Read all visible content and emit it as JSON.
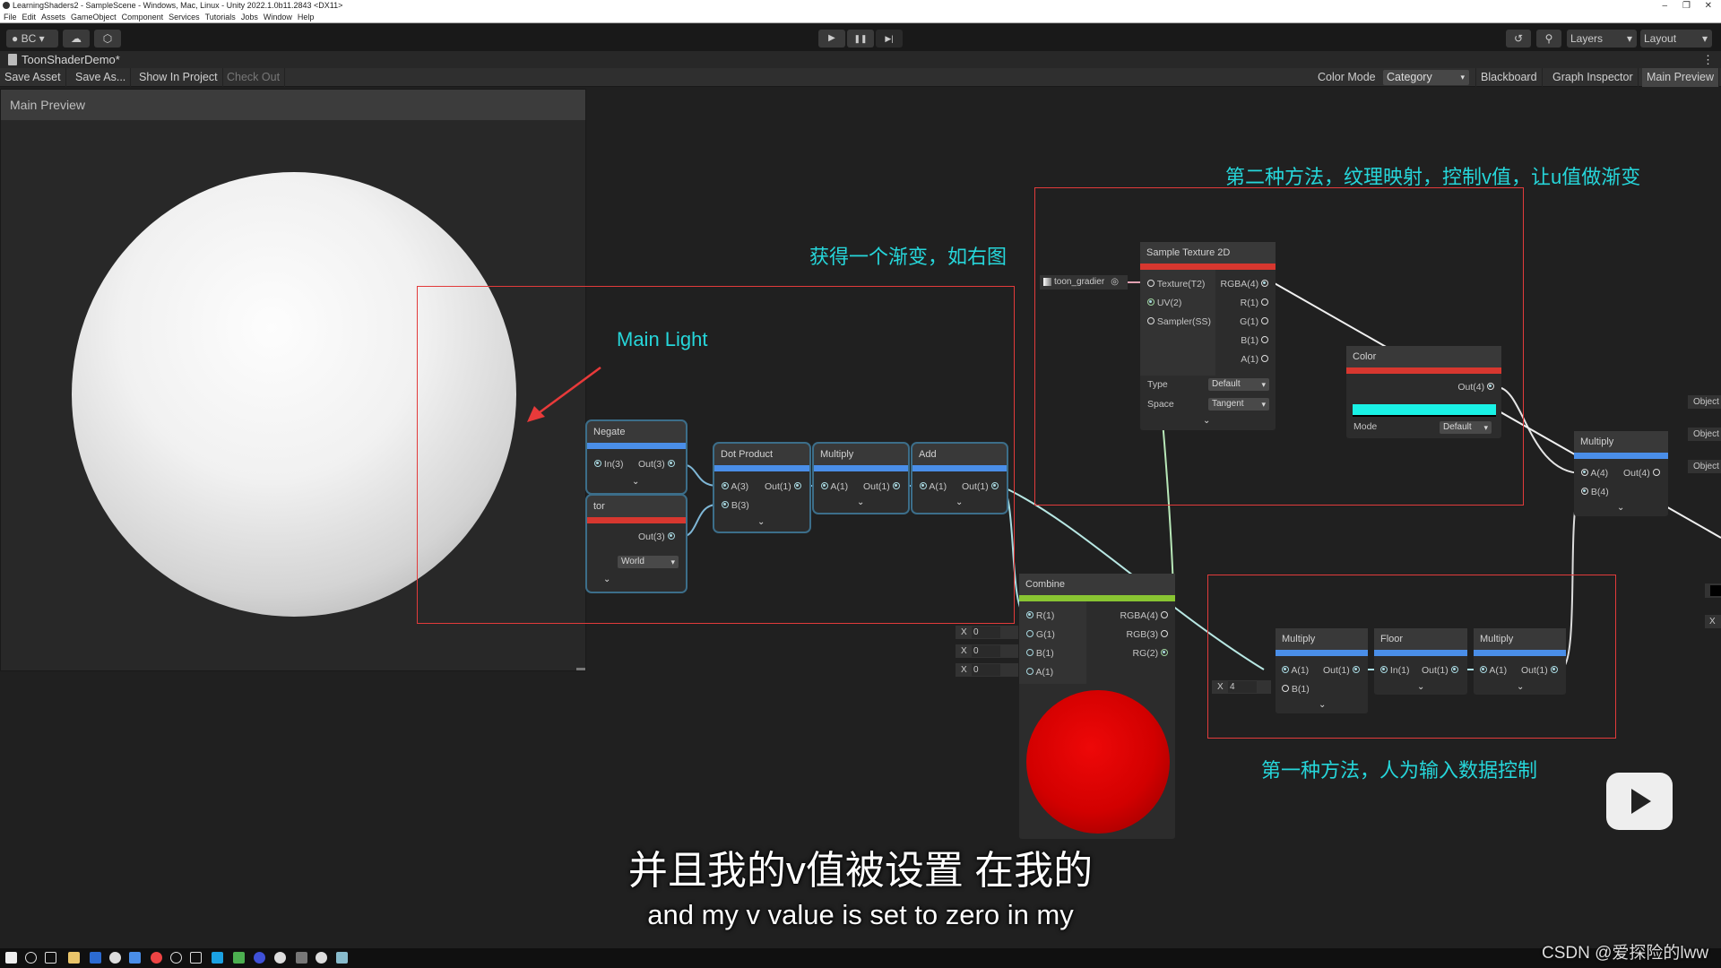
{
  "window": {
    "title": "LearningShaders2 - SampleScene - Windows, Mac, Linux - Unity 2022.1.0b11.2843 <DX11>",
    "controls": [
      "–",
      "❐",
      "✕"
    ]
  },
  "menu": [
    "File",
    "Edit",
    "Assets",
    "GameObject",
    "Component",
    "Services",
    "Tutorials",
    "Jobs",
    "Window",
    "Help"
  ],
  "toolbar": {
    "account": "BC",
    "layers": "Layers",
    "layout": "Layout",
    "play_icon": "▶",
    "pause_icon": "❚❚",
    "step_icon": "▶|"
  },
  "tab": {
    "title": "ToonShaderDemo*"
  },
  "graph_toolbar": {
    "save_asset": "Save Asset",
    "save_as": "Save As...",
    "show_in_project": "Show In Project",
    "check_out": "Check Out",
    "color_mode_label": "Color Mode",
    "color_mode_value": "Category",
    "blackboard": "Blackboard",
    "graph_inspector": "Graph Inspector",
    "main_preview": "Main Preview"
  },
  "main_preview": {
    "title": "Main Preview"
  },
  "nodes": {
    "negate": {
      "title": "Negate",
      "in": "In(3)",
      "out": "Out(3)"
    },
    "vector": {
      "title": "tor",
      "out": "Out(3)",
      "space": "World"
    },
    "dot": {
      "title": "Dot Product",
      "a": "A(3)",
      "b": "B(3)",
      "out": "Out(1)"
    },
    "mul1": {
      "title": "Multiply",
      "a": "A(1)",
      "out": "Out(1)"
    },
    "add": {
      "title": "Add",
      "a": "A(1)",
      "out": "Out(1)"
    },
    "sample": {
      "title": "Sample Texture 2D",
      "texture_asset": "toon_gradier",
      "inputs": [
        "Texture(T2)",
        "UV(2)",
        "Sampler(SS)"
      ],
      "outputs": [
        "RGBA(4)",
        "R(1)",
        "G(1)",
        "B(1)",
        "A(1)"
      ],
      "type_label": "Type",
      "type_value": "Default",
      "space_label": "Space",
      "space_value": "Tangent"
    },
    "color": {
      "title": "Color",
      "out": "Out(4)",
      "swatch": "#19f2e6",
      "mode_label": "Mode",
      "mode_value": "Default"
    },
    "mul_right": {
      "title": "Multiply",
      "a": "A(4)",
      "b": "B(4)",
      "out": "Out(4)"
    },
    "combine": {
      "title": "Combine",
      "inputs": [
        "R(1)",
        "G(1)",
        "B(1)",
        "A(1)"
      ],
      "outputs": [
        "RGBA(4)",
        "RGB(3)",
        "RG(2)"
      ],
      "x_values": [
        "0",
        "0",
        "0"
      ],
      "x_label": "X"
    },
    "mul2": {
      "title": "Multiply",
      "a": "A(1)",
      "b": "B(1)",
      "out": "Out(1)",
      "b_value": "4",
      "x_label": "X"
    },
    "floor": {
      "title": "Floor",
      "in": "In(1)",
      "out": "Out(1)"
    },
    "mul3": {
      "title": "Multiply",
      "a": "A(1)",
      "out": "Out(1)"
    }
  },
  "object_buttons": [
    "Object",
    "Object",
    "Object"
  ],
  "edge_x_label": "X",
  "annotations": {
    "main_light": "Main Light",
    "gradient": "获得一个渐变，如右图",
    "method2": "第二种方法，纹理映射，控制v值，让u值做渐变",
    "method1": "第一种方法，人为输入数据控制"
  },
  "subtitles": {
    "zh": "并且我的v值被设置 在我的",
    "en": "and my v value is set to zero in my"
  },
  "watermark": "CSDN @爱探险的lww",
  "colors": {
    "accent_cyan": "#26d6da",
    "annotation_red": "#e23b3b",
    "node_blue": "#4a8ee8",
    "node_red": "#d7372f",
    "node_green": "#89c532"
  }
}
